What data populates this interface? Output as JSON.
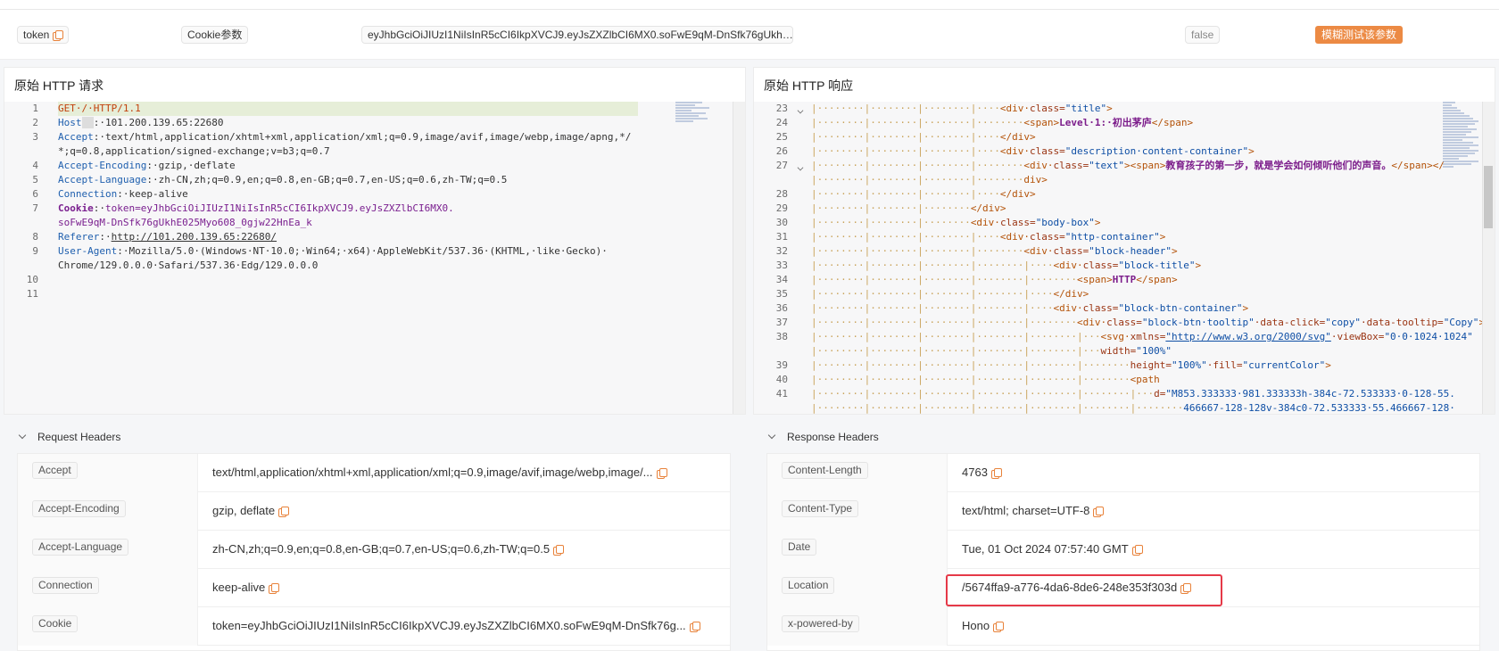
{
  "params_row": {
    "name": "token",
    "type": "Cookie参数",
    "value": "eyJhbGciOiJIUzI1NiIsInR5cCI6IkpXVCJ9.eyJsZXZlbCI6MX0.soFwE9qM-DnSfk76gUkh…",
    "required": "false",
    "fuzz_button": "模糊测试该参数"
  },
  "request_panel": {
    "title": "原始 HTTP 请求",
    "line_numbers": [
      "1",
      "2",
      "3",
      "",
      "4",
      "5",
      "6",
      "7",
      "",
      "8",
      "9",
      "",
      "10",
      "11"
    ]
  },
  "response_panel": {
    "title": "原始 HTTP 响应",
    "line_numbers": [
      "23",
      "24",
      "25",
      "26",
      "27",
      "",
      "28",
      "29",
      "30",
      "31",
      "32",
      "33",
      "34",
      "35",
      "36",
      "37",
      "38",
      "",
      "39",
      "40",
      "41",
      ""
    ]
  },
  "request_headers": {
    "title": "Request Headers",
    "rows": [
      {
        "key": "Accept",
        "value": "text/html,application/xhtml+xml,application/xml;q=0.9,image/avif,image/webp,image/..."
      },
      {
        "key": "Accept-Encoding",
        "value": "gzip, deflate"
      },
      {
        "key": "Accept-Language",
        "value": "zh-CN,zh;q=0.9,en;q=0.8,en-GB;q=0.7,en-US;q=0.6,zh-TW;q=0.5"
      },
      {
        "key": "Connection",
        "value": "keep-alive"
      },
      {
        "key": "Cookie",
        "value": "token=eyJhbGciOiJIUzI1NiIsInR5cCI6IkpXVCJ9.eyJsZXZlbCI6MX0.soFwE9qM-DnSfk76g..."
      }
    ]
  },
  "response_headers": {
    "title": "Response Headers",
    "rows": [
      {
        "key": "Content-Length",
        "value": "4763"
      },
      {
        "key": "Content-Type",
        "value": "text/html; charset=UTF-8"
      },
      {
        "key": "Date",
        "value": "Tue, 01 Oct 2024 07:57:40 GMT"
      },
      {
        "key": "Location",
        "value": "/5674ffa9-a776-4da6-8de6-248e353f303d"
      },
      {
        "key": "x-powered-by",
        "value": "Hono"
      }
    ]
  },
  "colors": {
    "accent": "#ec8a44",
    "highlight_border": "#e53948"
  }
}
